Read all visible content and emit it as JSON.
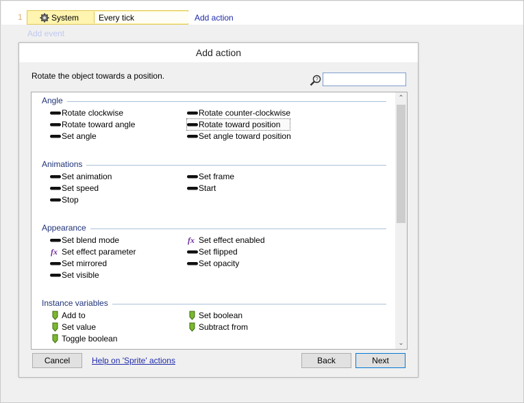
{
  "event_sheet": {
    "event_number": "1",
    "object": "System",
    "condition": "Every tick",
    "add_action_link": "Add action",
    "add_event_link": "Add event"
  },
  "dialog": {
    "title": "Add action",
    "description": "Rotate the object towards a position.",
    "search": {
      "value": "",
      "placeholder": ""
    },
    "groups": [
      {
        "name": "Angle",
        "items": [
          {
            "label": "Rotate clockwise",
            "icon": "action-icon"
          },
          {
            "label": "Rotate counter-clockwise",
            "icon": "action-icon"
          },
          {
            "label": "Rotate toward angle",
            "icon": "action-icon"
          },
          {
            "label": "Rotate toward position",
            "icon": "action-icon",
            "selected": true
          },
          {
            "label": "Set angle",
            "icon": "action-icon"
          },
          {
            "label": "Set angle toward position",
            "icon": "action-icon"
          }
        ]
      },
      {
        "name": "Animations",
        "items": [
          {
            "label": "Set animation",
            "icon": "action-icon"
          },
          {
            "label": "Set frame",
            "icon": "action-icon"
          },
          {
            "label": "Set speed",
            "icon": "action-icon"
          },
          {
            "label": "Start",
            "icon": "action-icon"
          },
          {
            "label": "Stop",
            "icon": "action-icon"
          }
        ]
      },
      {
        "name": "Appearance",
        "items": [
          {
            "label": "Set blend mode",
            "icon": "action-icon"
          },
          {
            "label": "Set effect enabled",
            "icon": "fx-icon"
          },
          {
            "label": "Set effect parameter",
            "icon": "fx-icon"
          },
          {
            "label": "Set flipped",
            "icon": "action-icon"
          },
          {
            "label": "Set mirrored",
            "icon": "action-icon"
          },
          {
            "label": "Set opacity",
            "icon": "action-icon"
          },
          {
            "label": "Set visible",
            "icon": "action-icon"
          }
        ]
      },
      {
        "name": "Instance variables",
        "items": [
          {
            "label": "Add to",
            "icon": "variable-icon"
          },
          {
            "label": "Set boolean",
            "icon": "variable-icon"
          },
          {
            "label": "Set value",
            "icon": "variable-icon"
          },
          {
            "label": "Subtract from",
            "icon": "variable-icon"
          },
          {
            "label": "Toggle boolean",
            "icon": "variable-icon"
          }
        ]
      }
    ],
    "buttons": {
      "cancel": "Cancel",
      "help": "Help on 'Sprite' actions",
      "back": "Back",
      "next": "Next"
    }
  },
  "colors": {
    "group_header": "#1e3278",
    "link": "#1e2aa8",
    "event_block": "#fff4b0",
    "fx_icon": "#7030a0",
    "variable_icon": "#7ab830"
  }
}
